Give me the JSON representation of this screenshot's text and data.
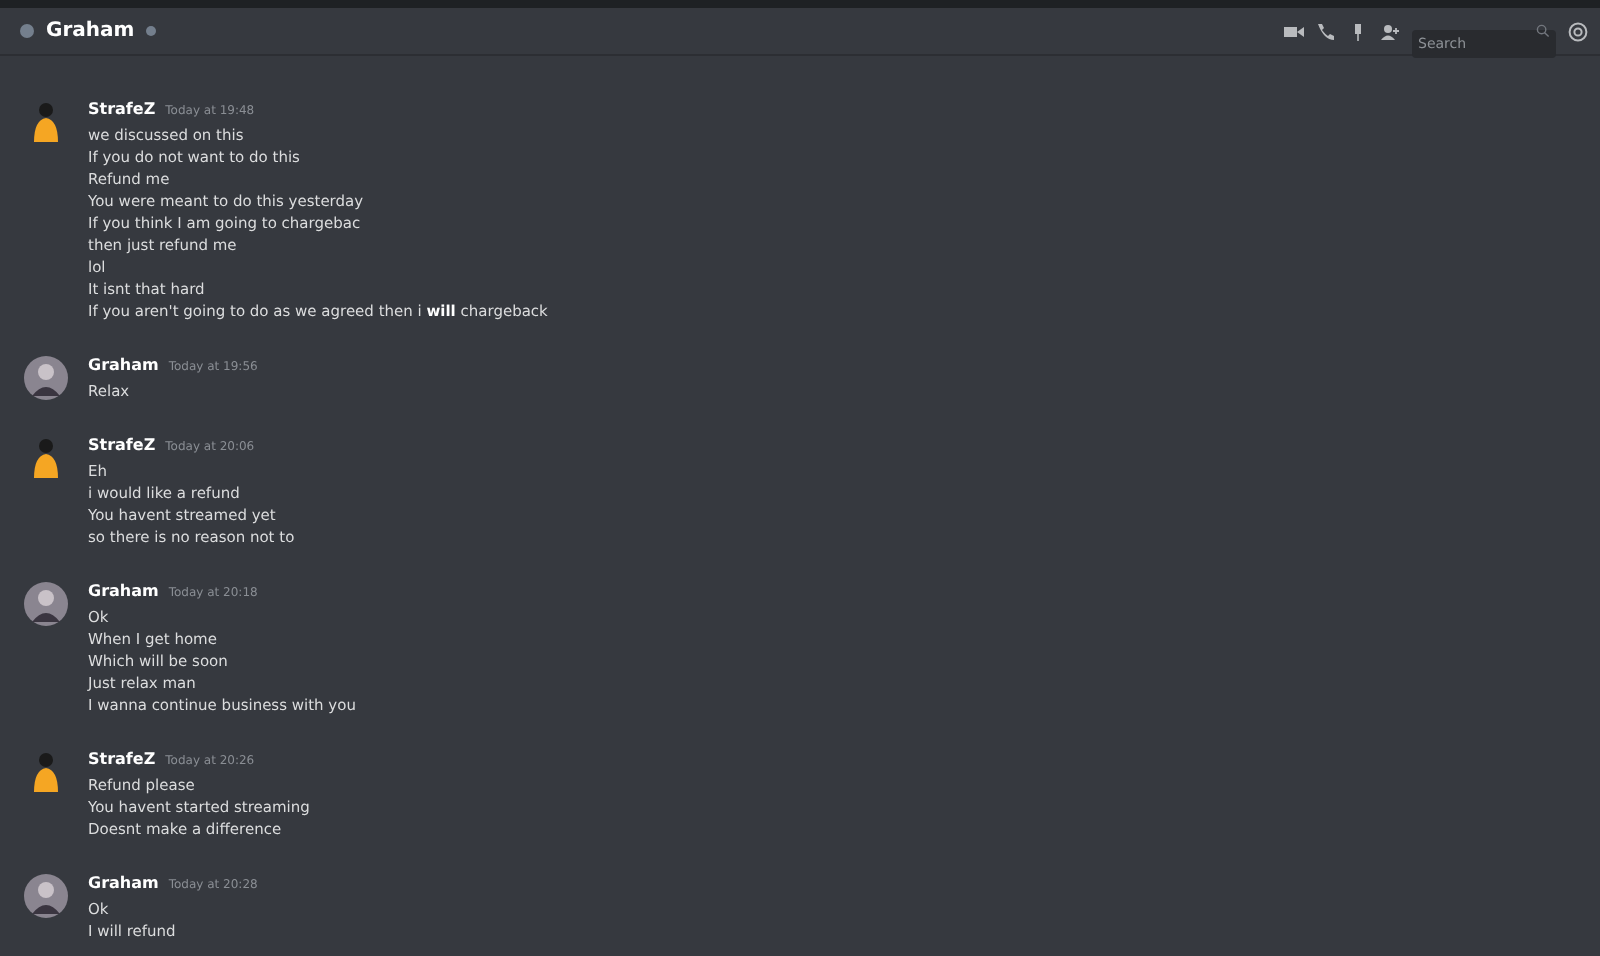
{
  "header": {
    "title": "Graham",
    "search": {
      "placeholder": "Search"
    }
  },
  "messages": [
    {
      "author": "StrafeZ",
      "kind": "strafez",
      "time": "Today at 19:48",
      "lines": [
        "we discussed on this",
        "If you do not want to do this",
        "Refund me",
        "You were meant to do this yesterday",
        "If you think I am going to chargebac",
        "then just refund me",
        "lol",
        "It isnt that hard",
        "If you aren't going to do as we agreed then i **will** chargeback"
      ]
    },
    {
      "author": "Graham",
      "kind": "graham",
      "time": "Today at 19:56",
      "lines": [
        "Relax"
      ]
    },
    {
      "author": "StrafeZ",
      "kind": "strafez",
      "time": "Today at 20:06",
      "lines": [
        "Eh",
        "i would like a refund",
        "You havent streamed yet",
        "so there is no reason not to"
      ]
    },
    {
      "author": "Graham",
      "kind": "graham",
      "time": "Today at 20:18",
      "lines": [
        "Ok",
        "When I get home",
        "Which will be soon",
        "Just relax man",
        "I wanna continue business with you"
      ]
    },
    {
      "author": "StrafeZ",
      "kind": "strafez",
      "time": "Today at 20:26",
      "lines": [
        "Refund please",
        "You havent started streaming",
        "Doesnt make a difference"
      ]
    },
    {
      "author": "Graham",
      "kind": "graham",
      "time": "Today at 20:28",
      "lines": [
        "Ok",
        "I will refund"
      ]
    }
  ]
}
